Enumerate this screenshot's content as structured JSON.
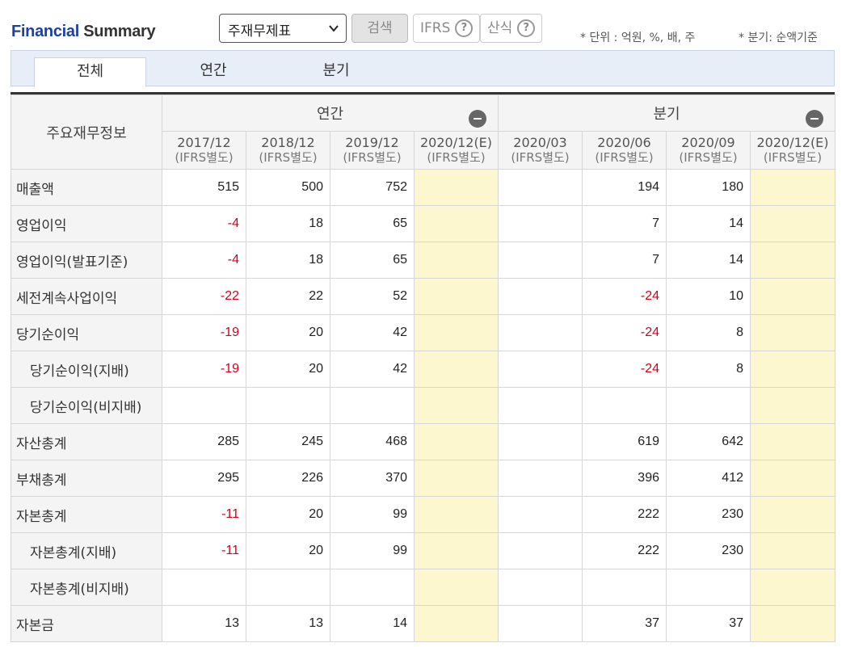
{
  "header": {
    "title_part1": "Financial",
    "title_part2": "Summary",
    "select_value": "주재무제표",
    "search_label": "검색",
    "ifrs_label": "IFRS",
    "formula_label": "산식",
    "help_glyph": "?",
    "note_unit": "* 단위 : 억원, %, 배, 주",
    "note_quarter": "* 분기: 순액기준"
  },
  "tabs": [
    "전체",
    "연간",
    "분기"
  ],
  "table": {
    "corner_label": "주요재무정보",
    "group_annual": "연간",
    "group_quarter": "분기",
    "columns": [
      {
        "period": "2017/12",
        "basis": "(IFRS별도)"
      },
      {
        "period": "2018/12",
        "basis": "(IFRS별도)"
      },
      {
        "period": "2019/12",
        "basis": "(IFRS별도)"
      },
      {
        "period": "2020/12(E)",
        "basis": "(IFRS별도)"
      },
      {
        "period": "2020/03",
        "basis": "(IFRS별도)"
      },
      {
        "period": "2020/06",
        "basis": "(IFRS별도)"
      },
      {
        "period": "2020/09",
        "basis": "(IFRS별도)"
      },
      {
        "period": "2020/12(E)",
        "basis": "(IFRS별도)"
      }
    ],
    "rows": [
      {
        "label": "매출액",
        "sub": false,
        "values": [
          "515",
          "500",
          "752",
          "",
          "",
          "194",
          "180",
          ""
        ]
      },
      {
        "label": "영업이익",
        "sub": false,
        "values": [
          "-4",
          "18",
          "65",
          "",
          "",
          "7",
          "14",
          ""
        ]
      },
      {
        "label": "영업이익(발표기준)",
        "sub": false,
        "values": [
          "-4",
          "18",
          "65",
          "",
          "",
          "7",
          "14",
          ""
        ]
      },
      {
        "label": "세전계속사업이익",
        "sub": false,
        "values": [
          "-22",
          "22",
          "52",
          "",
          "",
          "-24",
          "10",
          ""
        ]
      },
      {
        "label": "당기순이익",
        "sub": false,
        "values": [
          "-19",
          "20",
          "42",
          "",
          "",
          "-24",
          "8",
          ""
        ]
      },
      {
        "label": "당기순이익(지배)",
        "sub": true,
        "values": [
          "-19",
          "20",
          "42",
          "",
          "",
          "-24",
          "8",
          ""
        ]
      },
      {
        "label": "당기순이익(비지배)",
        "sub": true,
        "values": [
          "",
          "",
          "",
          "",
          "",
          "",
          "",
          ""
        ]
      },
      {
        "label": "자산총계",
        "sub": false,
        "values": [
          "285",
          "245",
          "468",
          "",
          "",
          "619",
          "642",
          ""
        ]
      },
      {
        "label": "부채총계",
        "sub": false,
        "values": [
          "295",
          "226",
          "370",
          "",
          "",
          "396",
          "412",
          ""
        ]
      },
      {
        "label": "자본총계",
        "sub": false,
        "values": [
          "-11",
          "20",
          "99",
          "",
          "",
          "222",
          "230",
          ""
        ]
      },
      {
        "label": "자본총계(지배)",
        "sub": true,
        "values": [
          "-11",
          "20",
          "99",
          "",
          "",
          "222",
          "230",
          ""
        ]
      },
      {
        "label": "자본총계(비지배)",
        "sub": true,
        "values": [
          "",
          "",
          "",
          "",
          "",
          "",
          "",
          ""
        ]
      },
      {
        "label": "자본금",
        "sub": false,
        "values": [
          "13",
          "13",
          "14",
          "",
          "",
          "37",
          "37",
          ""
        ]
      }
    ]
  },
  "colors": {
    "title_blue": "#1f3fa3",
    "negative": "#d0021b",
    "estimate_bg": "#fdf7cf"
  }
}
